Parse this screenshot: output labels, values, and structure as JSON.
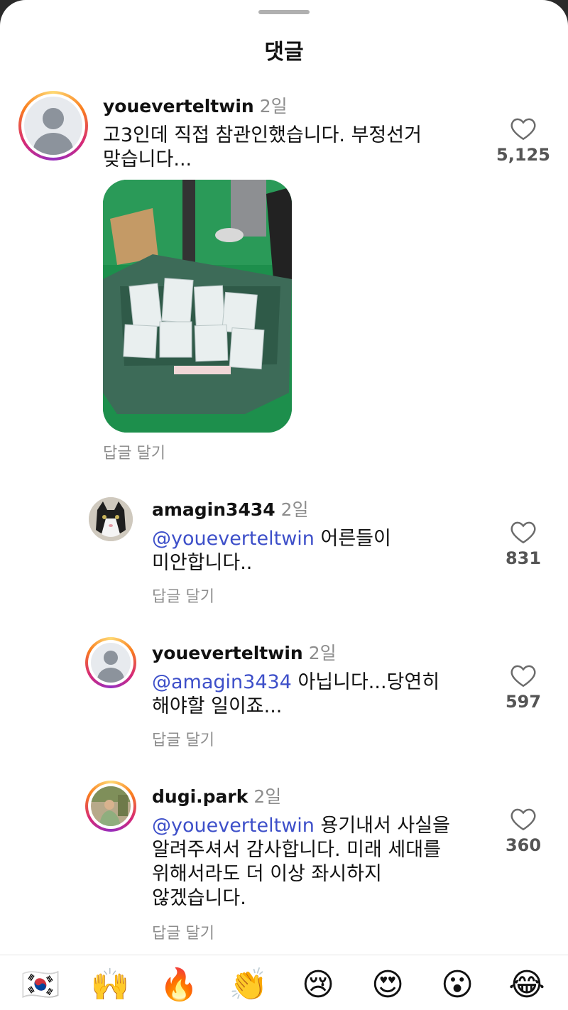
{
  "header": {
    "title": "댓글"
  },
  "comments": [
    {
      "username": "youeverteltwin",
      "time": "2일",
      "text": "고3인데 직접 참관인했습니다. 부정선거 맞습니다...",
      "text_line1": "고3인데 직접 참관인했습니다. 부정선거",
      "text_line2": "맞습니다...",
      "reply_label": "답글 달기",
      "likes": "5,125"
    },
    {
      "username": "amagin3434",
      "time": "2일",
      "mention": "@youeverteltwin",
      "text_line1": " 어른들이",
      "text_line2": "미안합니다..",
      "reply_label": "답글 달기",
      "likes": "831"
    },
    {
      "username": "youeverteltwin",
      "time": "2일",
      "mention": "@amagin3434",
      "text_line1": " 아닙니다...당연히",
      "text_line2": "해야할 일이죠...",
      "reply_label": "답글 달기",
      "likes": "597"
    },
    {
      "username": "dugi.park",
      "time": "2일",
      "mention": "@youeverteltwin",
      "text_line1": " 용기내서 사실을",
      "text_line2": "알려주셔서 감사합니다. 미래 세대를",
      "text_line3": "위해서라도 더 이상 좌시하지",
      "text_line4": "않겠습니다.",
      "reply_label": "답글 달기",
      "likes": "360"
    }
  ],
  "emoji_bar": [
    "🇰🇷",
    "🙌",
    "🔥",
    "👏",
    "😢",
    "😍",
    "😮",
    "😂"
  ],
  "icons": {
    "like": "heart-outline-icon",
    "mention_color": "#3d4fc9"
  }
}
